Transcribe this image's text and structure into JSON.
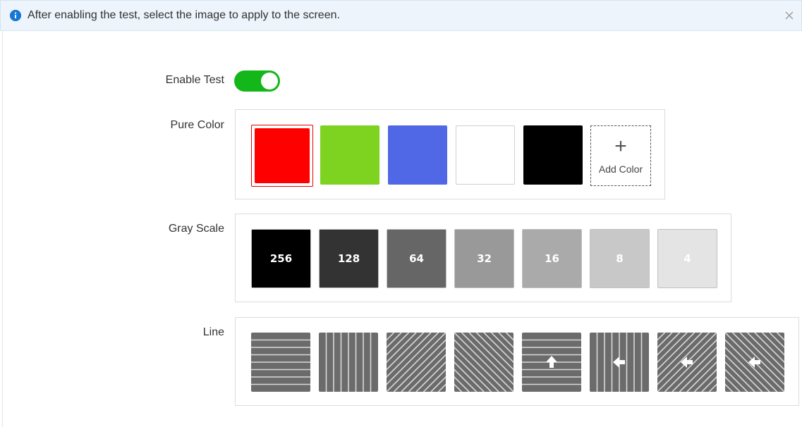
{
  "banner": {
    "info_icon": "info-icon",
    "text": "After enabling the test, select the image to apply to the screen.",
    "close_icon": "close-icon"
  },
  "enable_test": {
    "label": "Enable Test",
    "on": true
  },
  "pure_color": {
    "label": "Pure Color",
    "swatches": [
      {
        "color": "#ff0000",
        "selected": true
      },
      {
        "color": "#7ed321"
      },
      {
        "color": "#5068e6"
      },
      {
        "color": "#ffffff"
      },
      {
        "color": "#000000"
      }
    ],
    "add_color": {
      "icon": "plus-icon",
      "label": "Add Color"
    }
  },
  "gray_scale": {
    "label": "Gray Scale",
    "levels": [
      {
        "value": "256",
        "color": "#000000"
      },
      {
        "value": "128",
        "color": "#333333"
      },
      {
        "value": "64",
        "color": "#666666"
      },
      {
        "value": "32",
        "color": "#999999"
      },
      {
        "value": "16",
        "color": "#aaaaaa"
      },
      {
        "value": "8",
        "color": "#c8c8c8"
      },
      {
        "value": "4",
        "color": "#e4e4e4"
      }
    ]
  },
  "line": {
    "label": "Line",
    "patterns": [
      {
        "orientation": "horizontal",
        "arrow": "none"
      },
      {
        "orientation": "vertical",
        "arrow": "none"
      },
      {
        "orientation": "diagonal-right",
        "arrow": "none"
      },
      {
        "orientation": "diagonal-left",
        "arrow": "none"
      },
      {
        "orientation": "horizontal",
        "arrow": "up"
      },
      {
        "orientation": "vertical",
        "arrow": "left"
      },
      {
        "orientation": "diagonal-right",
        "arrow": "left"
      },
      {
        "orientation": "diagonal-left",
        "arrow": "left"
      }
    ]
  }
}
